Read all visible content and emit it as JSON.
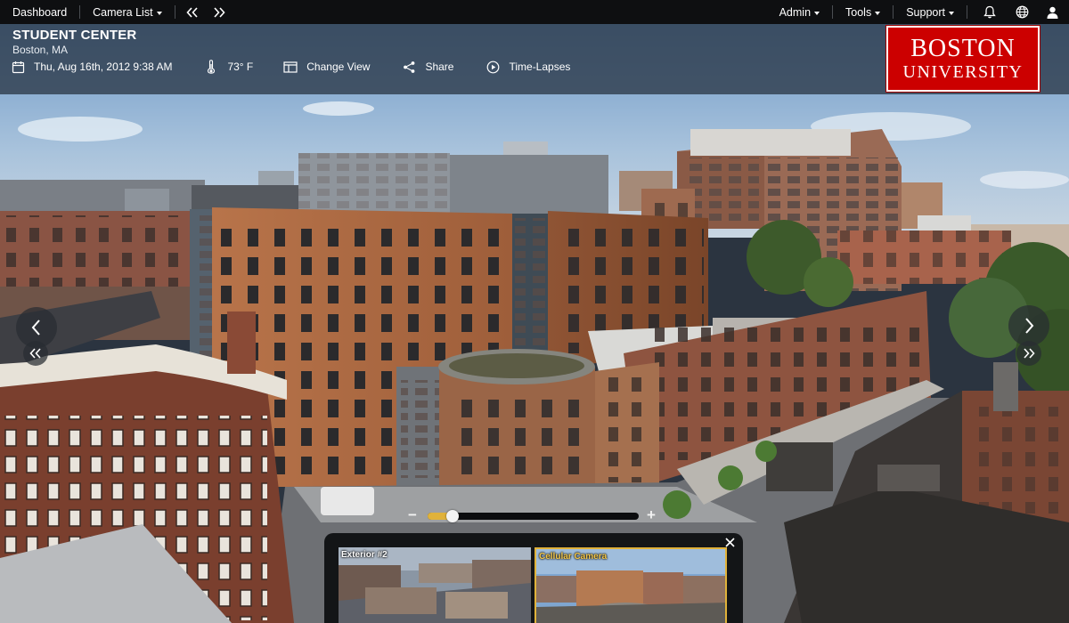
{
  "nav": {
    "dashboard": "Dashboard",
    "camera_list": "Camera List",
    "prev_icon": "double-chevron-left-icon",
    "next_icon": "double-chevron-right-icon",
    "admin": "Admin",
    "tools": "Tools",
    "support": "Support",
    "bell_icon": "bell-icon",
    "globe_icon": "globe-icon",
    "user_icon": "user-icon"
  },
  "site": {
    "title": "STUDENT CENTER",
    "location": "Boston, MA",
    "datetime": "Thu, Aug 16th, 2012 9:38 AM",
    "temperature": "73° F"
  },
  "actions": {
    "change_view": "Change View",
    "share": "Share",
    "time_lapses": "Time-Lapses"
  },
  "logo": {
    "line1": "BOSTON",
    "line2": "UNIVERSITY",
    "color": "#cc0000"
  },
  "zoom": {
    "minus": "−",
    "plus": "+",
    "level": 0.09
  },
  "cameras": [
    {
      "name": "Exterior #2",
      "selected": false
    },
    {
      "name": "Cellular Camera",
      "selected": true
    }
  ],
  "colors": {
    "accent": "#e0b23a",
    "topbar": "#0e0f11"
  }
}
